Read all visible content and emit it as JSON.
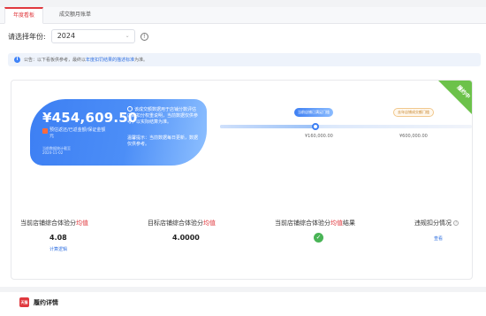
{
  "tabs": [
    {
      "label": "年度看板",
      "active": true
    },
    {
      "label": "成交额月账单",
      "active": false
    }
  ],
  "filter": {
    "label": "请选择年份:",
    "year": "2024"
  },
  "notice": {
    "text": "公告：以下看板供参考，最终以",
    "link": "年度扣罚结果的描述标准",
    "after": "为准。"
  },
  "card": {
    "ribbon": "履约中",
    "amount": "¥454,609.50",
    "amount_desc": "预估返还/已返金额/保证金额",
    "amount_desc2": "元",
    "small_note": "当前数据统计截至\n2024-11-02",
    "right_note": "该成交额数据用于店铺分数评估内的扣分权重说明，当前数据仅供参考，以实际结算为准。",
    "right_note2": "温馨提示：当前数据每日更新，数据仅供参考。",
    "progress": {
      "current_label": "当前店铺已满足门槛",
      "target_label": "去年店铺成交额门槛",
      "tick1": "¥160,000.00",
      "tick2": "¥600,000.00",
      "fill_fraction": 0.38
    },
    "metrics": [
      {
        "title_pre": "当前店铺综合体验分",
        "title_red": "均值",
        "value": "4.08",
        "link": "计算逻辑"
      },
      {
        "title_pre": "目标店铺综合体验分",
        "title_red": "均值",
        "value": "4.0000"
      },
      {
        "title_pre": "当前店铺综合体验分",
        "title_red": "均值",
        "title_post": "结果",
        "status": "pass"
      },
      {
        "title": "违规扣分情况",
        "link": "查看"
      }
    ]
  },
  "performance": {
    "logo_text": "天猫",
    "title": "履约详情"
  }
}
